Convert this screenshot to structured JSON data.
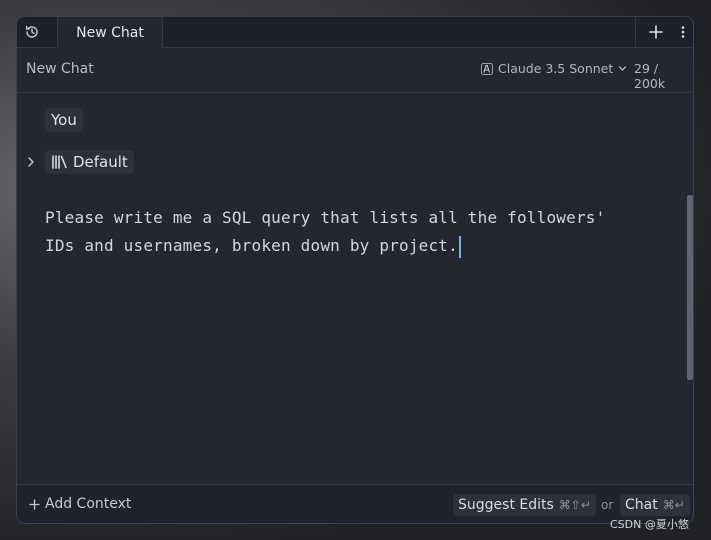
{
  "tabbar": {
    "history_icon": "history-icon",
    "tab_label": "New Chat",
    "new_icon": "plus-icon",
    "more_icon": "more-vertical-icon"
  },
  "header": {
    "title": "New Chat",
    "model_icon": "anthropic-icon",
    "model_name": "Claude 3.5 Sonnet",
    "token_count": "29 / 200k"
  },
  "message": {
    "author": "You",
    "context_label": "Default",
    "context_icon": "library-icon",
    "text": "Please write me a SQL query that lists all the followers'\nIDs and usernames, broken down by project."
  },
  "footer": {
    "add_context": "Add Context",
    "suggest_label": "Suggest Edits",
    "suggest_shortcut": "⌘⇧↵",
    "or": "or",
    "chat_label": "Chat",
    "chat_shortcut": "⌘↵"
  },
  "watermark": "CSDN @夏小悠",
  "colors": {
    "panel": "#232730",
    "tabbar": "#1e2129",
    "chip": "#2c313b",
    "caret": "#7fb0e0"
  }
}
